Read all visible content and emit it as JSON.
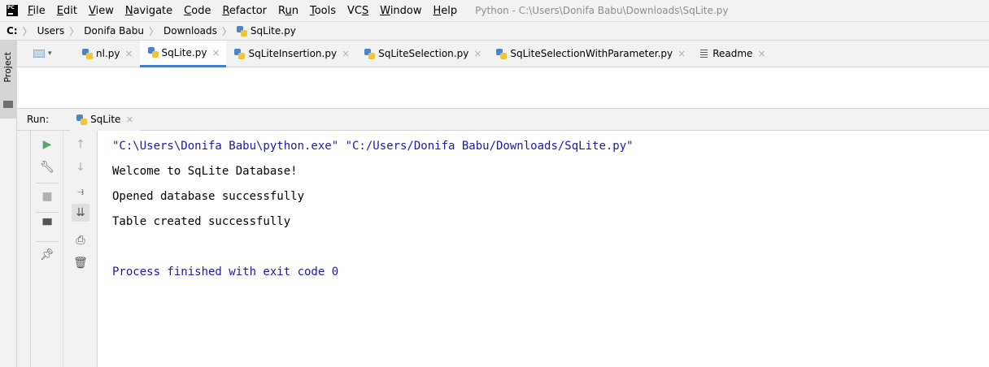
{
  "menubar": {
    "app_logo": "PC",
    "items": [
      {
        "label_u": "F",
        "label_rest": "ile"
      },
      {
        "label_u": "E",
        "label_rest": "dit"
      },
      {
        "label_u": "V",
        "label_rest": "iew"
      },
      {
        "label_u": "N",
        "label_rest": "avigate"
      },
      {
        "label_u": "C",
        "label_rest": "ode"
      },
      {
        "label_u": "R",
        "label_rest": "efactor"
      },
      {
        "label_pre": "R",
        "label_u": "u",
        "label_rest": "n"
      },
      {
        "label_u": "T",
        "label_rest": "ools"
      },
      {
        "label_pre": "VC",
        "label_u": "S",
        "label_rest": ""
      },
      {
        "label_u": "W",
        "label_rest": "indow"
      },
      {
        "label_u": "H",
        "label_rest": "elp"
      }
    ],
    "window_title": "Python - C:\\Users\\Donifa Babu\\Downloads\\SqLite.py"
  },
  "breadcrumb": {
    "items": [
      "C:",
      "Users",
      "Donifa Babu",
      "Downloads",
      "SqLite.py"
    ]
  },
  "project_strip": {
    "label": "Project"
  },
  "tabs": [
    {
      "label": "nl.py",
      "active": false
    },
    {
      "label": "SqLite.py",
      "active": true
    },
    {
      "label": "SqLiteInsertion.py",
      "active": false
    },
    {
      "label": "SqLiteSelection.py",
      "active": false
    },
    {
      "label": "SqLiteSelectionWithParameter.py",
      "active": false
    },
    {
      "label": "Readme",
      "active": false
    }
  ],
  "tab_close_glyph": "×",
  "run": {
    "label": "Run:",
    "tab_label": "SqLite"
  },
  "console": {
    "command_line": "\"C:\\Users\\Donifa Babu\\python.exe\" \"C:/Users/Donifa Babu/Downloads/SqLite.py\"",
    "output_lines": [
      "Welcome to SqLite Database!",
      "Opened database successfully",
      "Table created successfully"
    ],
    "exit_message": "Process finished with exit code 0"
  },
  "colors": {
    "accent": "#4083c9",
    "console_blue": "#1a1aa6",
    "run_green": "#59a869"
  }
}
